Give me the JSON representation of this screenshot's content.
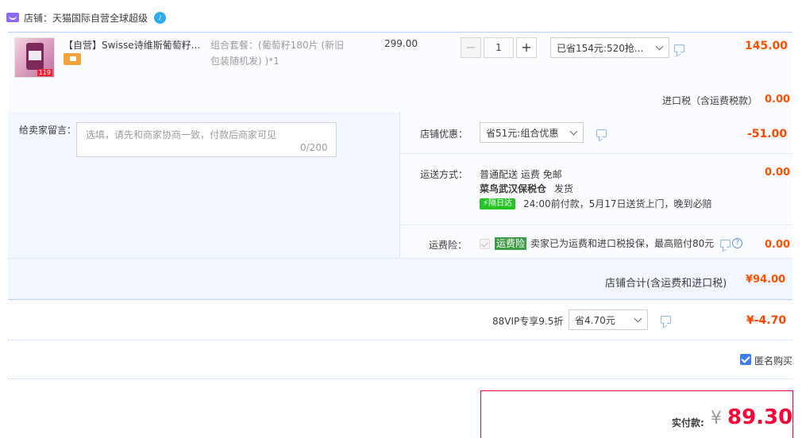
{
  "shop": {
    "label": "店铺：天猫国际自营全球超级",
    "chat_badge": "♪"
  },
  "item": {
    "title": "【自营】Swisse诗维斯葡萄籽...",
    "img_tag": "119",
    "sku_line1": "组合套餐：(葡萄籽180片 (新旧",
    "sku_line2": "包装随机发) )*1",
    "unit_price": "299.00",
    "qty_minus": "−",
    "qty_value": "1",
    "qty_plus": "+",
    "promo_select": "已省154元:520抢...",
    "subtotal": "145.00"
  },
  "tax": {
    "label": "进口税（含运费税款）",
    "value": "0.00"
  },
  "message": {
    "label": "给卖家留言：",
    "placeholder": "选填，请先和商家协商一致，付款后商家可见",
    "count": "0/200"
  },
  "shop_discount": {
    "label": "店铺优惠：",
    "select": "省51元:组合优惠",
    "value": "-51.00"
  },
  "shipping": {
    "label": "运送方式：",
    "line1": "普通配送 运费 免邮",
    "warehouse": "菜鸟武汉保税仓",
    "ship_text": "发货",
    "badge": "⚡隔日达",
    "line3": "24:00前付款，5月17日送货上门，晚到必赔",
    "value": "0.00"
  },
  "insurance": {
    "label": "运费险：",
    "badge": "运费险",
    "text": "卖家已为运费和进口税投保，最高赔付80元",
    "q": "?",
    "value": "0.00"
  },
  "shop_total": {
    "label": "店铺合计(含运费和进口税)",
    "value": "¥94.00"
  },
  "vip": {
    "label": "88VIP专享9.5折",
    "select": "省4.70元",
    "value": "¥-4.70"
  },
  "anonymous": {
    "label": "匿名购买"
  },
  "payment": {
    "label": "实付款:",
    "currency": "¥",
    "amount": "89.30"
  },
  "colors": {
    "accent_red": "#ff0036",
    "price_orange": "#ff5000",
    "border_blue": "#b2d1ff",
    "checkbox_blue": "#3d7ff0"
  }
}
